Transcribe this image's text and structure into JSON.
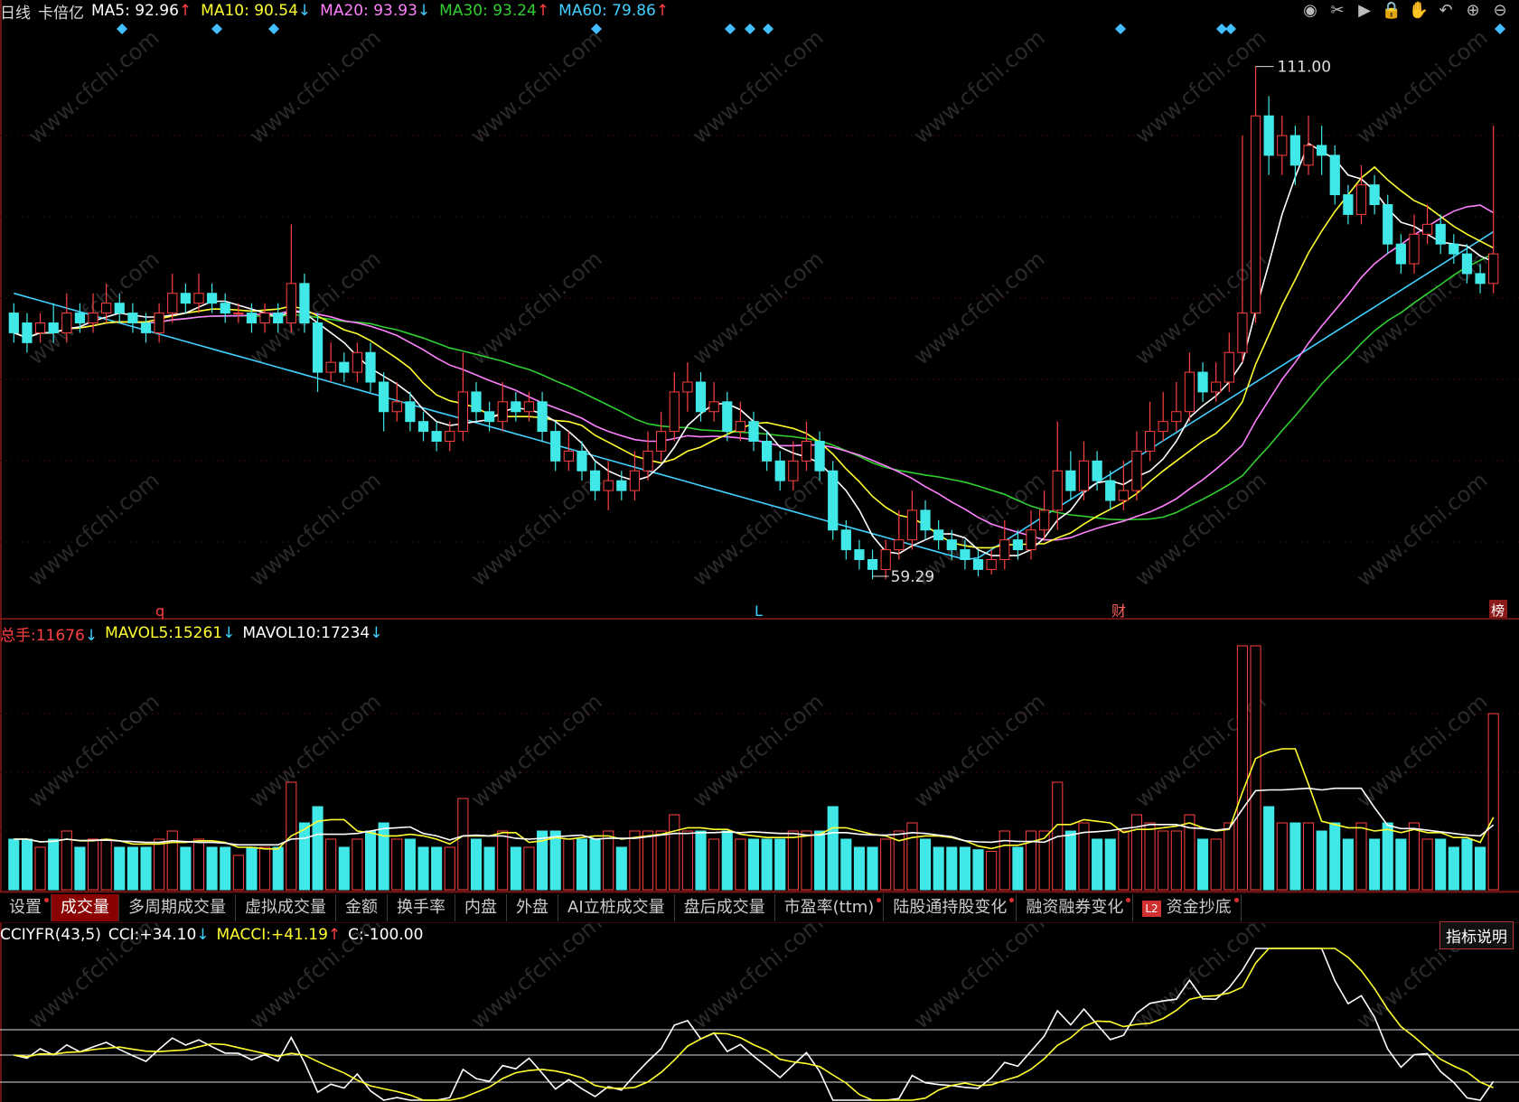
{
  "header": {
    "period": "日线",
    "stock": "卡倍亿",
    "ma": [
      {
        "label": "MA5: ",
        "value": "92.96",
        "arrow": "↑",
        "color": "#ffffff"
      },
      {
        "label": "MA10: ",
        "value": "90.54",
        "arrow": "↓",
        "color": "#ffff30"
      },
      {
        "label": "MA20: ",
        "value": "93.93",
        "arrow": "↓",
        "color": "#ff80ff"
      },
      {
        "label": "MA30: ",
        "value": "93.24",
        "arrow": "↑",
        "color": "#30d030"
      },
      {
        "label": "MA60: ",
        "value": "79.86",
        "arrow": "↑",
        "color": "#40d0ff"
      }
    ]
  },
  "toolbar_icons": [
    "eye-icon",
    "scissors-icon",
    "play-icon",
    "lock-icon",
    "hand-icon",
    "undo-icon",
    "zoom-in-icon",
    "zoom-out-icon"
  ],
  "price_annotations": {
    "high": "111.00",
    "low": "59.29"
  },
  "markers": {
    "q": "q",
    "l": "L",
    "cai": "财",
    "bang": "榜"
  },
  "volume_legend": {
    "total_label": "总手: ",
    "total_value": "11676",
    "total_arrow": "↓",
    "mavol5_label": "MAVOL5: ",
    "mavol5_value": "15261",
    "mavol5_arrow": "↓",
    "mavol10_label": "MAVOL10: ",
    "mavol10_value": "17234",
    "mavol10_arrow": "↓"
  },
  "tabs": [
    {
      "label": "设置",
      "active": false,
      "dot": true
    },
    {
      "label": "成交量",
      "active": true,
      "dot": false
    },
    {
      "label": "多周期成交量",
      "active": false,
      "dot": false
    },
    {
      "label": "虚拟成交量",
      "active": false,
      "dot": false
    },
    {
      "label": "金额",
      "active": false,
      "dot": false
    },
    {
      "label": "换手率",
      "active": false,
      "dot": false
    },
    {
      "label": "内盘",
      "active": false,
      "dot": false
    },
    {
      "label": "外盘",
      "active": false,
      "dot": false
    },
    {
      "label": "AI立桩成交量",
      "active": false,
      "dot": false
    },
    {
      "label": "盘后成交量",
      "active": false,
      "dot": false
    },
    {
      "label": "市盈率(ttm)",
      "active": false,
      "dot": true
    },
    {
      "label": "陆股通持股变化",
      "active": false,
      "dot": true
    },
    {
      "label": "融资融券变化",
      "active": false,
      "dot": true
    },
    {
      "label": "资金抄底",
      "active": false,
      "dot": true,
      "badge": "L2"
    }
  ],
  "cci_legend": {
    "name": "CCIYFR(43,5)",
    "cci_label": "CCI: ",
    "cci_value": "+34.10",
    "cci_arrow": "↓",
    "macci_label": "MACCI: ",
    "macci_value": "+41.19",
    "macci_arrow": "↑",
    "c_label": "C: ",
    "c_value": "-100.00"
  },
  "help_button": "指标说明",
  "watermark": "www.cfchi.com",
  "colors": {
    "up": "#ff4040",
    "down": "#40e8e8",
    "ma5": "#ffffff",
    "ma10": "#ffff30",
    "ma20": "#ff80ff",
    "ma30": "#30d030",
    "ma60": "#40d0ff",
    "diamond": "#40c0ff"
  },
  "chart_data": {
    "type": "candlestick",
    "price_range": [
      55,
      115
    ],
    "candles": [
      [
        86,
        84,
        87,
        83
      ],
      [
        85,
        83,
        86,
        82
      ],
      [
        84,
        85,
        86,
        83
      ],
      [
        85,
        84,
        87,
        83
      ],
      [
        84,
        86,
        88,
        83
      ],
      [
        86,
        85,
        87,
        84
      ],
      [
        85,
        86,
        88,
        84
      ],
      [
        86,
        87,
        89,
        85
      ],
      [
        87,
        86,
        88,
        85
      ],
      [
        86,
        85,
        87,
        84
      ],
      [
        85,
        84,
        86,
        83
      ],
      [
        84,
        86,
        87,
        83
      ],
      [
        86,
        88,
        90,
        85
      ],
      [
        88,
        87,
        89,
        86
      ],
      [
        87,
        88,
        90,
        86
      ],
      [
        88,
        87,
        89,
        86
      ],
      [
        87,
        86,
        88,
        85
      ],
      [
        86,
        86,
        87,
        85
      ],
      [
        86,
        85,
        87,
        84
      ],
      [
        85,
        86,
        87,
        84
      ],
      [
        86,
        85,
        87,
        84
      ],
      [
        85,
        89,
        95,
        84
      ],
      [
        89,
        85,
        90,
        84
      ],
      [
        85,
        80,
        86,
        78
      ],
      [
        80,
        81,
        83,
        79
      ],
      [
        81,
        80,
        82,
        79
      ],
      [
        80,
        82,
        83,
        79
      ],
      [
        82,
        79,
        83,
        78
      ],
      [
        79,
        76,
        80,
        74
      ],
      [
        76,
        77,
        79,
        75
      ],
      [
        77,
        75,
        78,
        74
      ],
      [
        75,
        74,
        76,
        73
      ],
      [
        74,
        73,
        75,
        72
      ],
      [
        73,
        74,
        75,
        72
      ],
      [
        74,
        78,
        82,
        73
      ],
      [
        78,
        76,
        79,
        75
      ],
      [
        76,
        75,
        77,
        74
      ],
      [
        75,
        77,
        79,
        74
      ],
      [
        77,
        76,
        78,
        75
      ],
      [
        76,
        77,
        78,
        75
      ],
      [
        77,
        74,
        78,
        73
      ],
      [
        74,
        71,
        75,
        70
      ],
      [
        71,
        72,
        74,
        70
      ],
      [
        72,
        70,
        73,
        69
      ],
      [
        70,
        68,
        71,
        67
      ],
      [
        68,
        69,
        71,
        66
      ],
      [
        69,
        68,
        70,
        67
      ],
      [
        68,
        70,
        72,
        67
      ],
      [
        70,
        72,
        74,
        69
      ],
      [
        72,
        74,
        76,
        71
      ],
      [
        74,
        78,
        80,
        73
      ],
      [
        78,
        79,
        81,
        76
      ],
      [
        79,
        76,
        80,
        75
      ],
      [
        76,
        77,
        79,
        75
      ],
      [
        77,
        74,
        78,
        73
      ],
      [
        74,
        75,
        77,
        73
      ],
      [
        75,
        73,
        76,
        72
      ],
      [
        73,
        71,
        74,
        70
      ],
      [
        71,
        69,
        72,
        68
      ],
      [
        69,
        71,
        73,
        68
      ],
      [
        71,
        73,
        75,
        70
      ],
      [
        73,
        70,
        74,
        69
      ],
      [
        70,
        64,
        71,
        63
      ],
      [
        64,
        62,
        65,
        61
      ],
      [
        62,
        61,
        63,
        60
      ],
      [
        61,
        60,
        62,
        59
      ],
      [
        60,
        62,
        63,
        59
      ],
      [
        62,
        63,
        66,
        61
      ],
      [
        63,
        66,
        68,
        62
      ],
      [
        66,
        64,
        67,
        63
      ],
      [
        64,
        63,
        65,
        62
      ],
      [
        63,
        62,
        64,
        61
      ],
      [
        62,
        61,
        63,
        60
      ],
      [
        61,
        60,
        62,
        59.3
      ],
      [
        60,
        61,
        62,
        59.5
      ],
      [
        61,
        63,
        65,
        60
      ],
      [
        63,
        62,
        64,
        61
      ],
      [
        62,
        64,
        66,
        61
      ],
      [
        64,
        66,
        68,
        63
      ],
      [
        66,
        70,
        75,
        64
      ],
      [
        70,
        68,
        72,
        67
      ],
      [
        68,
        71,
        73,
        67
      ],
      [
        71,
        69,
        72,
        68
      ],
      [
        69,
        67,
        70,
        66
      ],
      [
        67,
        68,
        71,
        66
      ],
      [
        68,
        72,
        74,
        67
      ],
      [
        72,
        74,
        77,
        71
      ],
      [
        74,
        75,
        78,
        73
      ],
      [
        75,
        76,
        79,
        74
      ],
      [
        76,
        80,
        82,
        75
      ],
      [
        80,
        78,
        81,
        77
      ],
      [
        78,
        79,
        81,
        77
      ],
      [
        79,
        82,
        84,
        78
      ],
      [
        82,
        86,
        104,
        81
      ],
      [
        86,
        106,
        111,
        85
      ],
      [
        106,
        102,
        108,
        100
      ],
      [
        102,
        104,
        106,
        100
      ],
      [
        104,
        101,
        105,
        99
      ],
      [
        101,
        103,
        106,
        100
      ],
      [
        103,
        102,
        105,
        100
      ],
      [
        102,
        98,
        103,
        97
      ],
      [
        98,
        96,
        99,
        95
      ],
      [
        96,
        99,
        101,
        95
      ],
      [
        99,
        97,
        100,
        96
      ],
      [
        97,
        93,
        98,
        92
      ],
      [
        93,
        91,
        94,
        90
      ],
      [
        91,
        94,
        96,
        90
      ],
      [
        94,
        95,
        97,
        93
      ],
      [
        95,
        93,
        96,
        92
      ],
      [
        93,
        92,
        94,
        91
      ],
      [
        92,
        90,
        93,
        89
      ],
      [
        90,
        89,
        91,
        88
      ],
      [
        89,
        92,
        105,
        88
      ]
    ]
  }
}
